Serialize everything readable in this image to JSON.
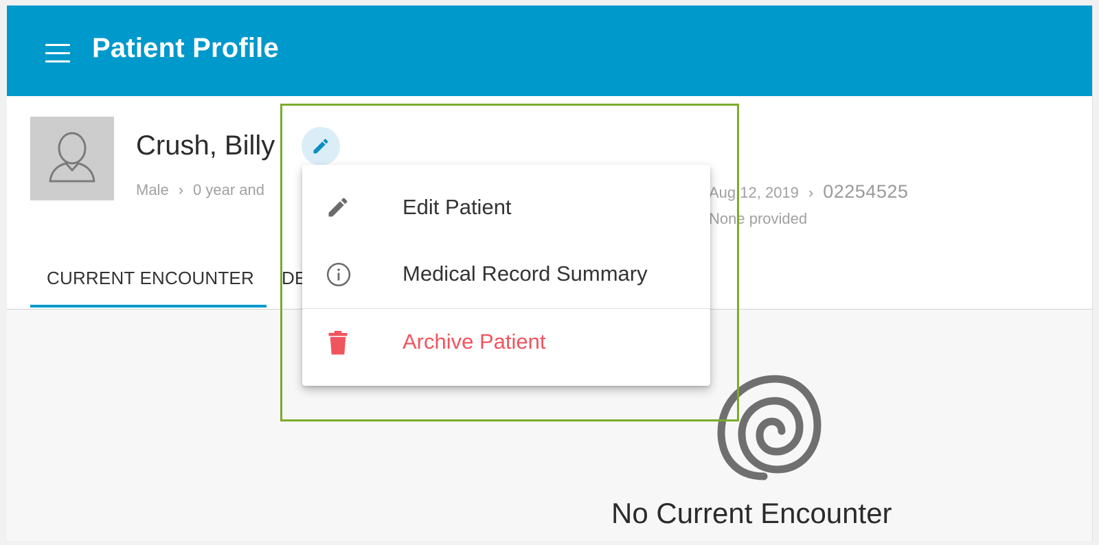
{
  "app": {
    "title": "Patient Profile",
    "accent_color": "#0099cc",
    "danger_color": "#f0545e",
    "highlight_color": "#7aab2c"
  },
  "appbar": {
    "menu_icon": "hamburger-menu-icon"
  },
  "patient": {
    "name": "Crush, Billy",
    "sex": "Male",
    "age": "0 year and",
    "dob": "Aug 12, 2019",
    "mrn": "02254525",
    "secondary": "None provided"
  },
  "tabs": [
    {
      "label": "CURRENT ENCOUNTER",
      "active": true
    },
    {
      "label": "DE",
      "active": false
    }
  ],
  "menu": {
    "items": [
      {
        "label": "Edit Patient",
        "icon": "pencil-icon"
      },
      {
        "label": "Medical Record Summary",
        "icon": "info-circle-icon"
      },
      {
        "label": "Archive Patient",
        "icon": "trash-icon"
      }
    ]
  },
  "empty_state": {
    "message": "No Current Encounter",
    "icon": "spiral-logo-icon"
  }
}
